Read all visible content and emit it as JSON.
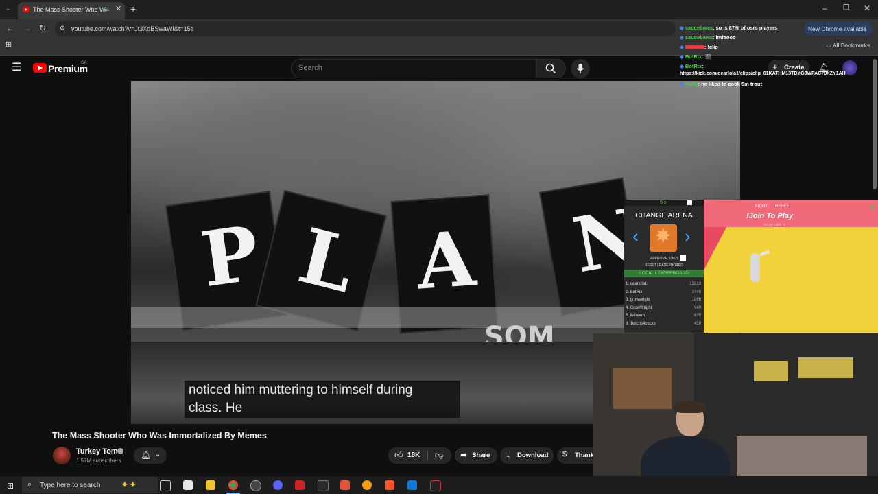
{
  "browser": {
    "tab_title": "The Mass Shooter Who Was Immortalized By Memes",
    "url": "youtube.com/watch?v=Jt3XdBSwaWI&t=15s",
    "new_chrome_label": "New Chrome available",
    "all_bookmarks_label": "All Bookmarks"
  },
  "youtube": {
    "logo_text": "Premium",
    "region": "CA",
    "search_placeholder": "Search",
    "create_label": "Create",
    "video_title": "The Mass Shooter Who Was Immortalized By Memes",
    "channel_name": "Turkey Tom",
    "subscribers": "1.57M subscribers",
    "likes": "18K",
    "share_label": "Share",
    "download_label": "Download",
    "thanks_label": "Thank",
    "caption_line1": "noticed him muttering to himself during",
    "caption_line2": "class. He",
    "flag_letters": [
      "P",
      "L",
      "A",
      "N"
    ],
    "banner_text": "SOM"
  },
  "chat": [
    {
      "user": "saucebaws",
      "msg": ": so is 87% of osrs players",
      "color": "#46d046"
    },
    {
      "user": "saucebaws",
      "msg": ": lmfaooo",
      "color": "#46d046"
    },
    {
      "user": "",
      "msg": ": !clip",
      "color": "#e23b3b"
    },
    {
      "user": "BotRix",
      "msg": ": 🎬",
      "color": "#46d046"
    },
    {
      "user": "BotRix",
      "msg": ":",
      "color": "#46d046"
    },
    {
      "user": "",
      "msg": "https://kick.com/dearlola1/clips/clip_01KATHM13TDYGJWPAC78XZY1AH",
      "color": "#ffffff"
    },
    {
      "user": "Nulty",
      "msg": ": he liked to cook 5m trout",
      "color": "#46d046"
    }
  ],
  "game": {
    "timer": "5 s",
    "change_arena": "CHANGE ARENA",
    "approval_only": "APPROVAL ONLY",
    "reset_leaderboard": "RESET LEADERBOARD",
    "local_leaderboard": "LOCAL LEADERBOARD",
    "fight": "FIGHT!",
    "reset": "RESET",
    "join": "!Join To Play",
    "players": "PLAYERS: 1",
    "leaderboard": [
      {
        "rank": "1.",
        "name": "dearlola1",
        "score": "13613"
      },
      {
        "rank": "2.",
        "name": "BotRix",
        "score": "3740"
      },
      {
        "rank": "3.",
        "name": "growwright",
        "score": "1866"
      },
      {
        "rank": "4.",
        "name": "GrowWright",
        "score": "949"
      },
      {
        "rank": "5.",
        "name": "ifaheem",
        "score": "635"
      },
      {
        "rank": "6.",
        "name": "1wichs4cucks",
        "score": "459"
      }
    ]
  },
  "taskbar": {
    "search_placeholder": "Type here to search"
  }
}
